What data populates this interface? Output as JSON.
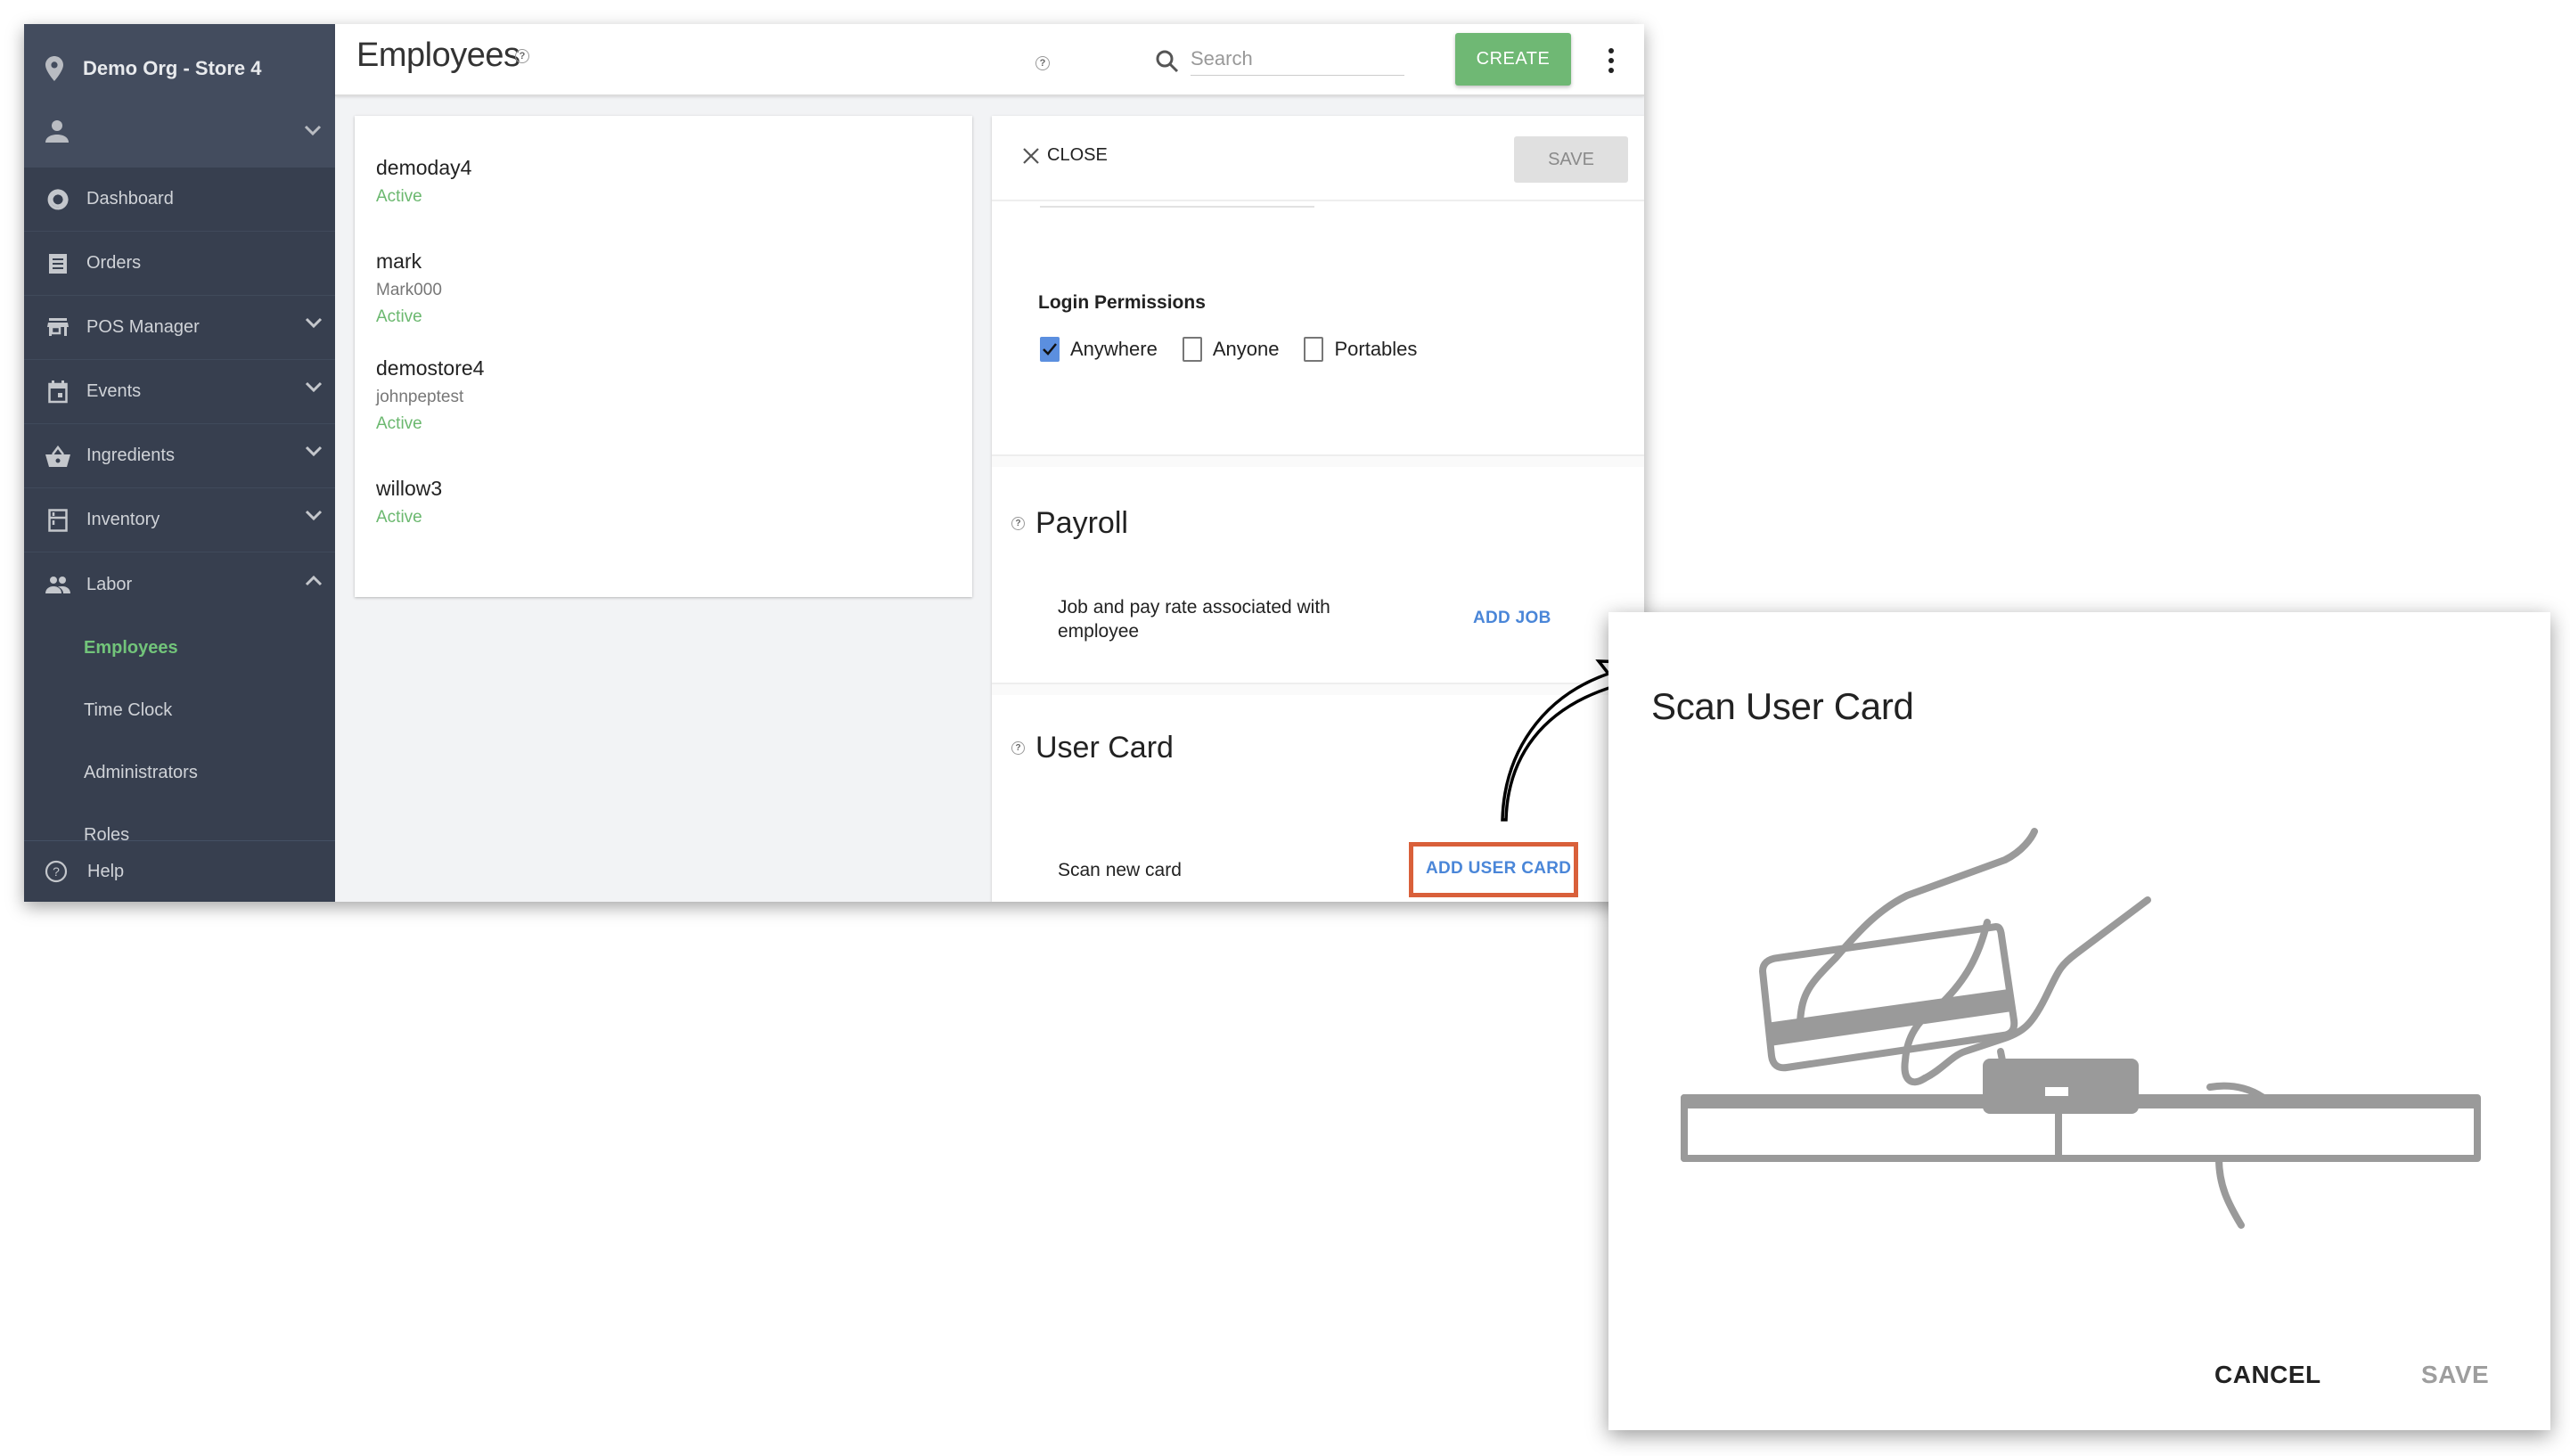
{
  "sidebar": {
    "org_name": "Demo Org - Store 4",
    "nav": [
      {
        "label": "Dashboard",
        "icon": "dashboard-icon",
        "expandable": false
      },
      {
        "label": "Orders",
        "icon": "receipt-icon",
        "expandable": false
      },
      {
        "label": "POS Manager",
        "icon": "store-icon",
        "expandable": true
      },
      {
        "label": "Events",
        "icon": "calendar-icon",
        "expandable": true
      },
      {
        "label": "Ingredients",
        "icon": "basket-icon",
        "expandable": true
      },
      {
        "label": "Inventory",
        "icon": "inventory-icon",
        "expandable": true
      },
      {
        "label": "Labor",
        "icon": "people-icon",
        "expandable": true,
        "expanded": true
      }
    ],
    "labor_sub": [
      {
        "label": "Employees",
        "active": true
      },
      {
        "label": "Time Clock",
        "active": false
      },
      {
        "label": "Administrators",
        "active": false
      },
      {
        "label": "Roles",
        "active": false
      }
    ],
    "help_label": "Help"
  },
  "header": {
    "title": "Employees",
    "search_placeholder": "Search",
    "search_value": "",
    "create_label": "CREATE"
  },
  "employees": [
    {
      "name": "demoday4",
      "username": "",
      "status": "Active"
    },
    {
      "name": "mark",
      "username": "Mark000",
      "status": "Active"
    },
    {
      "name": "demostore4",
      "username": "johnpeptest",
      "status": "Active"
    },
    {
      "name": "willow3",
      "username": "",
      "status": "Active"
    }
  ],
  "detail": {
    "close_label": "CLOSE",
    "save_label": "SAVE",
    "login_permissions": {
      "title": "Login Permissions",
      "options": [
        {
          "label": "Anywhere",
          "checked": true
        },
        {
          "label": "Anyone",
          "checked": false
        },
        {
          "label": "Portables",
          "checked": false
        }
      ]
    },
    "payroll": {
      "title": "Payroll",
      "description": "Job and pay rate associated with employee",
      "action": "ADD JOB"
    },
    "user_card": {
      "title": "User Card",
      "description": "Scan new card",
      "action": "ADD USER CARD"
    }
  },
  "dialog": {
    "title": "Scan User Card",
    "illustration": "hand-swiping-card-over-reader",
    "cancel_label": "CANCEL",
    "save_label": "SAVE"
  },
  "colors": {
    "sidebar_bg": "#373f4f",
    "sidebar_top_bg": "#434c5e",
    "active_green": "#72c47a",
    "create_green": "#6fb874",
    "link_blue": "#4a86d8",
    "checkbox_blue": "#5b8fdf",
    "highlight_orange": "#d9603a"
  }
}
